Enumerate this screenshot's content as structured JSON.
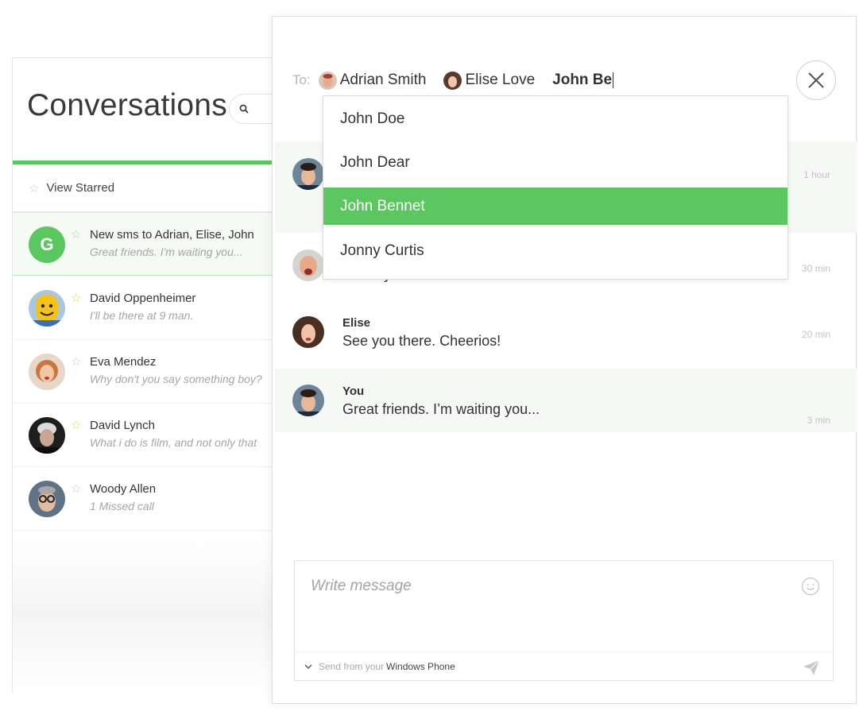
{
  "conversations": {
    "title": "Conversations",
    "search_icon": "search-icon",
    "view_starred": "View Starred",
    "items": [
      {
        "avatar_letter": "G",
        "starred": false,
        "name": "New sms to Adrian, Elise, John",
        "preview": "Great friends. I'm waiting you..."
      },
      {
        "starred": true,
        "name": "David Oppenheimer",
        "preview": "I'll be there at 9 man."
      },
      {
        "starred": false,
        "name": "Eva Mendez",
        "preview": "Why don't you say something boy?"
      },
      {
        "starred": true,
        "name": "David Lynch",
        "preview": "What i do is film, and not only that"
      },
      {
        "starred": false,
        "name": "Woody Allen",
        "preview": "1 Missed call"
      }
    ]
  },
  "compose": {
    "to_label": "To:",
    "recipients": [
      {
        "name": "Adrian Smith"
      },
      {
        "name": "Elise Love"
      }
    ],
    "typing": "John Be",
    "suggestions": [
      {
        "name": "John Doe",
        "selected": false
      },
      {
        "name": "John Dear",
        "selected": false
      },
      {
        "name": "John Bennet",
        "selected": true
      },
      {
        "name": "Jonny Curtis",
        "selected": false
      }
    ],
    "messages": [
      {
        "name": "",
        "text": "",
        "time": "1 hour"
      },
      {
        "name": "",
        "text": "Sunday. I'll be there.",
        "time": "30 min"
      },
      {
        "name": "Elise",
        "text": "See you there. Cheerios!",
        "time": "20 min"
      },
      {
        "name": "You",
        "text": "Great friends. I’m waiting you...",
        "time": "3 min"
      }
    ],
    "composer": {
      "placeholder": "Write message",
      "send_from": "Send from your",
      "device": "Windows Phone"
    }
  },
  "colors": {
    "accent": "#5cc760",
    "star_on": "#f1cf2b"
  }
}
